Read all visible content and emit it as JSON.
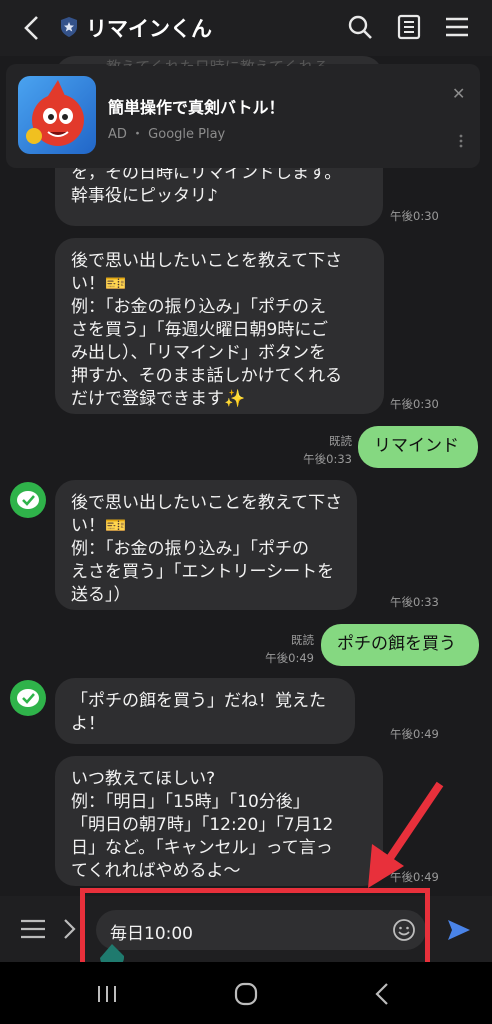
{
  "header": {
    "title": "リマインくん"
  },
  "ad": {
    "title": "簡単操作で真剣バトル！",
    "source": "AD ・ Google Play",
    "close": "✕",
    "partial_text": "教えてくれた日時に教えてくれる"
  },
  "messages": [
    {
      "lines": [
        "を，その日時にリマインドします。",
        "幹事役にピッタリ♪"
      ],
      "time": "午後0:30"
    },
    {
      "lines": [
        "後で思い出したいことを教えて下さ",
        "い！🎫",
        "例：「お金の振り込み」「ポチのえ",
        "さを買う」「毎週火曜日朝9時にご",
        "み出し）、「リマインド」ボタンを",
        "押すか、そのまま話しかけてくれる",
        "だけで登録できます✨"
      ],
      "time": "午後0:30"
    },
    {
      "text": "リマインド",
      "read": "既読",
      "time": "午後0:33"
    },
    {
      "lines": [
        "後で思い出したいことを教えて下さ",
        "い！🎫",
        " 例：「お金の振り込み」「ポチの",
        "えさを買う」「エントリーシートを",
        "送る」）"
      ],
      "time": "午後0:33"
    },
    {
      "text": "ポチの餌を買う",
      "read": "既読",
      "time": "午後0:49"
    },
    {
      "lines": [
        "「ポチの餌を買う」だね！覚えた",
        "よ！"
      ],
      "time": "午後0:49"
    },
    {
      "lines": [
        "いつ教えてほしい?",
        "例：「明日」「15時」「10分後」",
        "「明日の朝7時」「12:20」「7月12",
        "日」など。「キャンセル」って言っ",
        "てくれればやめるよ〜"
      ],
      "time": "午後0:49"
    }
  ],
  "input": {
    "value": "毎日10:00"
  },
  "colors": {
    "accent_green": "#85d881",
    "highlight_red": "#e8303b",
    "send_blue": "#4a84e8"
  }
}
